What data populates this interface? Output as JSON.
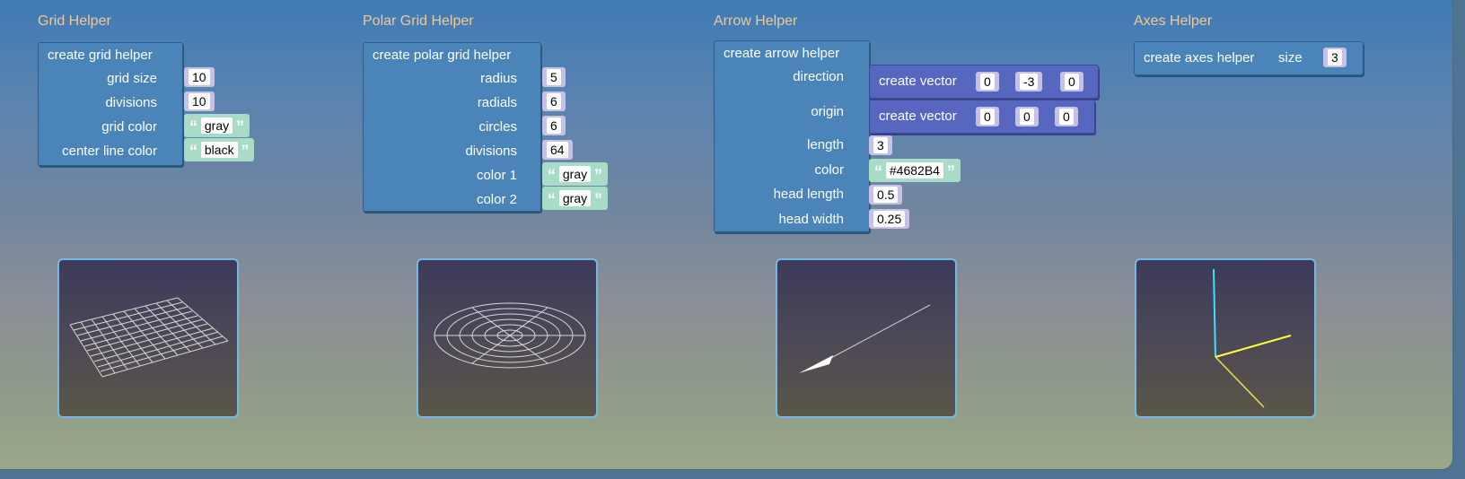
{
  "grid_helper": {
    "title": "Grid Helper",
    "block_label": "create grid helper",
    "grid_size_label": "grid size",
    "grid_size": "10",
    "divisions_label": "divisions",
    "divisions": "10",
    "grid_color_label": "grid color",
    "grid_color": "gray",
    "center_line_color_label": "center line color",
    "center_line_color": "black"
  },
  "polar_grid_helper": {
    "title": "Polar Grid Helper",
    "block_label": "create polar grid helper",
    "radius_label": "radius",
    "radius": "5",
    "radials_label": "radials",
    "radials": "6",
    "circles_label": "circles",
    "circles": "6",
    "divisions_label": "divisions",
    "divisions": "64",
    "color1_label": "color 1",
    "color1": "gray",
    "color2_label": "color 2",
    "color2": "gray"
  },
  "arrow_helper": {
    "title": "Arrow Helper",
    "block_label": "create arrow helper",
    "direction_label": "direction",
    "direction_vector": {
      "label": "create vector",
      "x": "0",
      "y": "-3",
      "z": "0"
    },
    "origin_label": "origin",
    "origin_vector": {
      "label": "create vector",
      "x": "0",
      "y": "0",
      "z": "0"
    },
    "length_label": "length",
    "length": "3",
    "color_label": "color",
    "color": "#4682B4",
    "head_length_label": "head length",
    "head_length": "0.5",
    "head_width_label": "head width",
    "head_width": "0.25"
  },
  "axes_helper": {
    "title": "Axes Helper",
    "block_label": "create axes helper",
    "size_label": "size",
    "size": "3"
  },
  "colors": {
    "block": "#4b84b8",
    "vector_block": "#5767bf",
    "number_field": "#c6c1e6",
    "string_field": "#a9dcc7",
    "section_title": "#f1c899",
    "axis_x": "#ffff40",
    "axis_y": "#40e0ff",
    "axis_z": "#e8e050"
  }
}
